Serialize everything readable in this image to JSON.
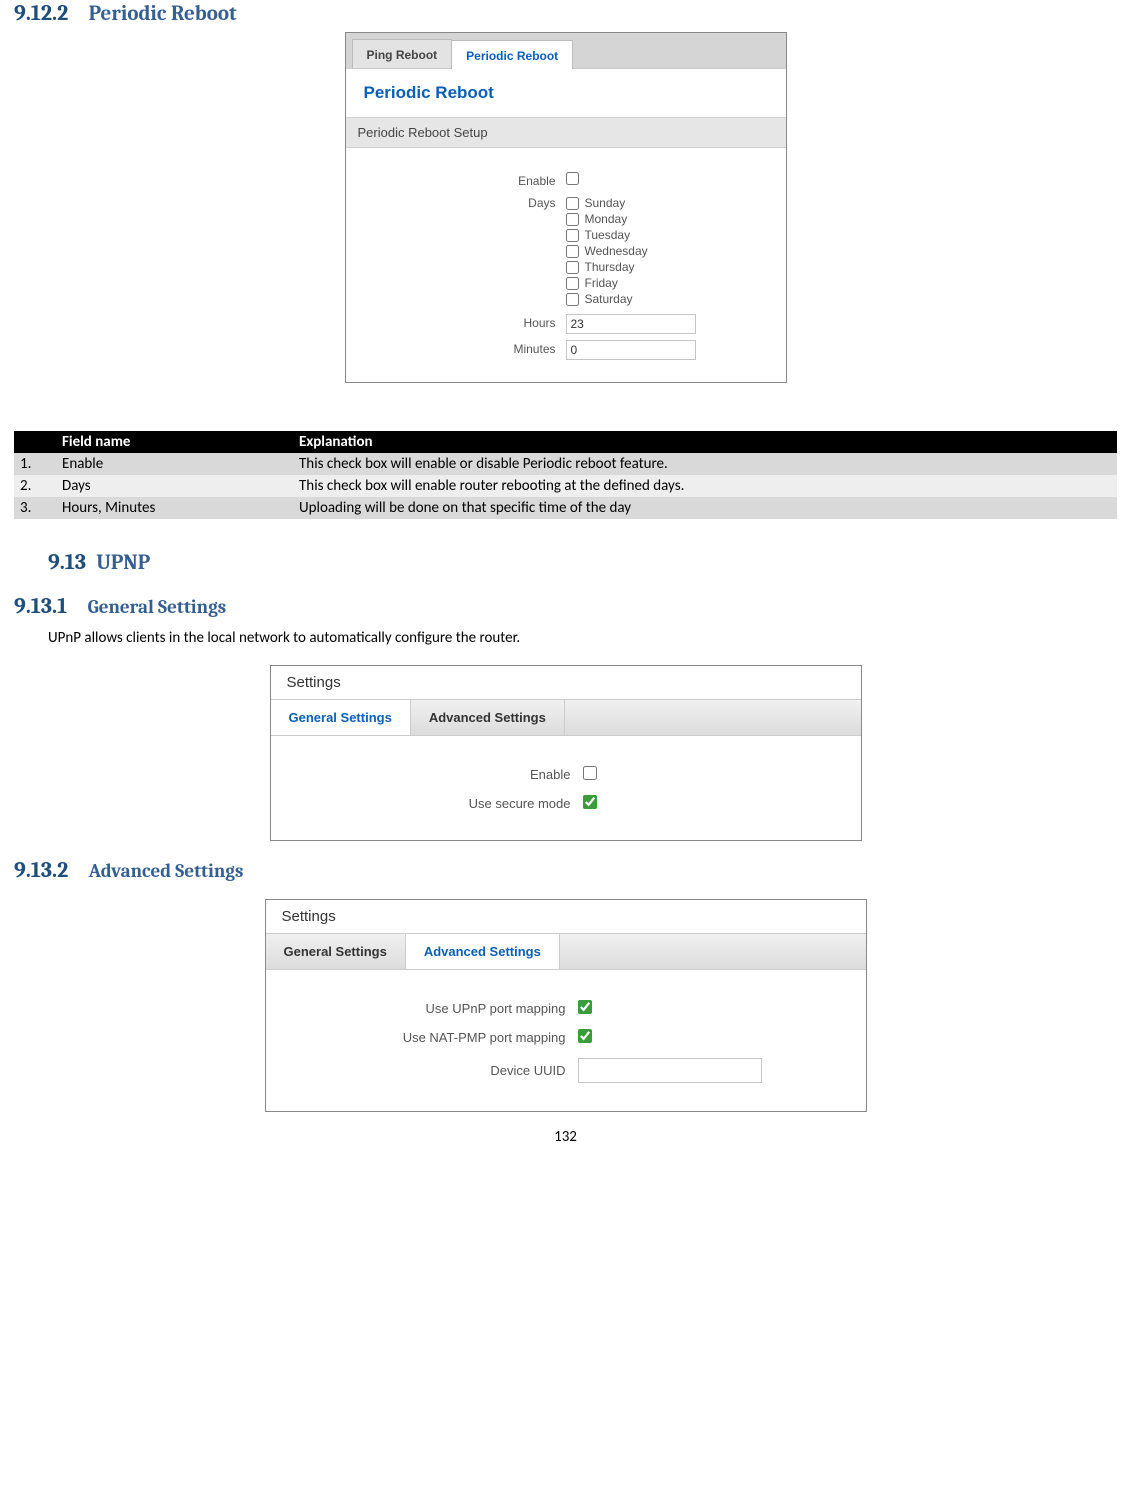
{
  "sections": {
    "s1": {
      "num": "9.12.2",
      "title": "Periodic Reboot"
    },
    "s2": {
      "num": "9.13",
      "title": "UPNP"
    },
    "s3": {
      "num": "9.13.1",
      "title": "General Settings"
    },
    "s4": {
      "num": "9.13.2",
      "title": "Advanced Settings"
    }
  },
  "body": {
    "upnp_desc": "UPnP allows clients in the local network to automatically configure the router."
  },
  "reboot_panel": {
    "tabs": {
      "ping": "Ping Reboot",
      "periodic": "Periodic Reboot"
    },
    "title": "Periodic Reboot",
    "subhead": "Periodic Reboot Setup",
    "labels": {
      "enable": "Enable",
      "days": "Days",
      "hours": "Hours",
      "minutes": "Minutes"
    },
    "days": {
      "sun": "Sunday",
      "mon": "Monday",
      "tue": "Tuesday",
      "wed": "Wednesday",
      "thu": "Thursday",
      "fri": "Friday",
      "sat": "Saturday"
    },
    "values": {
      "hours": "23",
      "minutes": "0"
    }
  },
  "exp_table": {
    "headers": {
      "num": "",
      "field": "Field name",
      "expl": "Explanation"
    },
    "rows": [
      {
        "num": "1.",
        "field": "Enable",
        "expl": "This check box will enable or disable Periodic reboot feature."
      },
      {
        "num": "2.",
        "field": "Days",
        "expl": "This check box will enable router rebooting at the defined days."
      },
      {
        "num": "3.",
        "field": "Hours, Minutes",
        "expl": "Uploading will be done on that specific time of the day"
      }
    ]
  },
  "upnp_general": {
    "header": "Settings",
    "tabs": {
      "general": "General Settings",
      "advanced": "Advanced Settings"
    },
    "labels": {
      "enable": "Enable",
      "secure": "Use secure mode"
    }
  },
  "upnp_advanced": {
    "header": "Settings",
    "tabs": {
      "general": "General Settings",
      "advanced": "Advanced Settings"
    },
    "labels": {
      "upnp": "Use UPnP port mapping",
      "nat": "Use NAT-PMP port mapping",
      "uuid": "Device UUID"
    }
  },
  "page_number": "132"
}
